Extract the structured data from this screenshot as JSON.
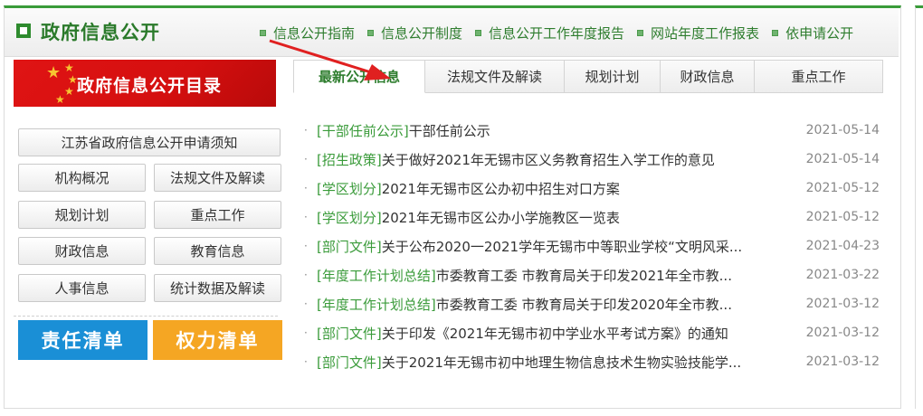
{
  "header": {
    "title": "政府信息公开",
    "nav": [
      "信息公开指南",
      "信息公开制度",
      "信息公开工作年度报告",
      "网站年度工作报表",
      "依申请公开"
    ]
  },
  "sidebar": {
    "banner": "政府信息公开目录",
    "apply_notice": "江苏省政府信息公开申请须知",
    "buttons": [
      "机构概况",
      "法规文件及解读",
      "规划计划",
      "重点工作",
      "财政信息",
      "教育信息",
      "人事信息",
      "统计数据及解读"
    ],
    "responsibility_list": "责任清单",
    "power_list": "权力清单"
  },
  "tabs": [
    "最新公开信息",
    "法规文件及解读",
    "规划计划",
    "财政信息",
    "重点工作"
  ],
  "list": [
    {
      "category": "[干部任前公示]",
      "title": "干部任前公示",
      "date": "2021-05-14"
    },
    {
      "category": "[招生政策]",
      "title": "关于做好2021年无锡市区义务教育招生入学工作的意见",
      "date": "2021-05-14"
    },
    {
      "category": "[学区划分]",
      "title": "2021年无锡市区公办初中招生对口方案",
      "date": "2021-05-12"
    },
    {
      "category": "[学区划分]",
      "title": "2021年无锡市区公办小学施教区一览表",
      "date": "2021-05-12"
    },
    {
      "category": "[部门文件]",
      "title": "关于公布2020一2021学年无锡市中等职业学校“文明风采...",
      "date": "2021-04-23"
    },
    {
      "category": "[年度工作计划总结]",
      "title": "市委教育工委  市教育局关于印发2021年全市教...",
      "date": "2021-03-22"
    },
    {
      "category": "[年度工作计划总结]",
      "title": "市委教育工委  市教育局关于印发2020年全市教...",
      "date": "2021-03-12"
    },
    {
      "category": "[部门文件]",
      "title": "关于印发《2021年无锡市初中学业水平考试方案》的通知",
      "date": "2021-03-12"
    },
    {
      "category": "[部门文件]",
      "title": "关于2021年无锡市初中地理生物信息技术生物实验技能学...",
      "date": "2021-03-12"
    }
  ],
  "colors": {
    "brand_green": "#2e7d2e",
    "accent_red": "#d40f0f",
    "responsibility_blue": "#1a8fd6",
    "power_orange": "#f5a623"
  },
  "icons": {
    "header": "square-icon",
    "nav_bullet": "square-bullet-icon",
    "banner_decoration": "star-icon",
    "annotation": "red-arrow-icon"
  }
}
